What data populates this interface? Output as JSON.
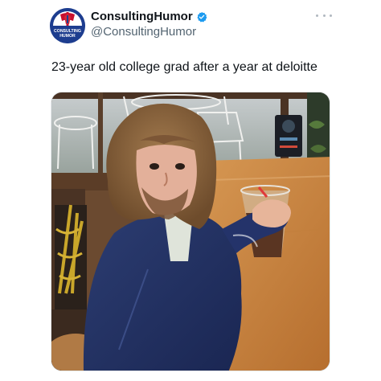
{
  "tweet": {
    "author": {
      "display_name": "ConsultingHumor",
      "handle": "@ConsultingHumor",
      "avatar_text_line1": "CONSULTING",
      "avatar_text_line2": "HUMOR",
      "verified": true
    },
    "text": "23-year old college grad after a year at deloitte",
    "colors": {
      "verified": "#1d9bf0",
      "avatar_bg": "#1d3d8f",
      "handle": "#536471"
    },
    "icons": {
      "more": "more-dots-icon",
      "verified": "verified-badge-icon"
    }
  }
}
